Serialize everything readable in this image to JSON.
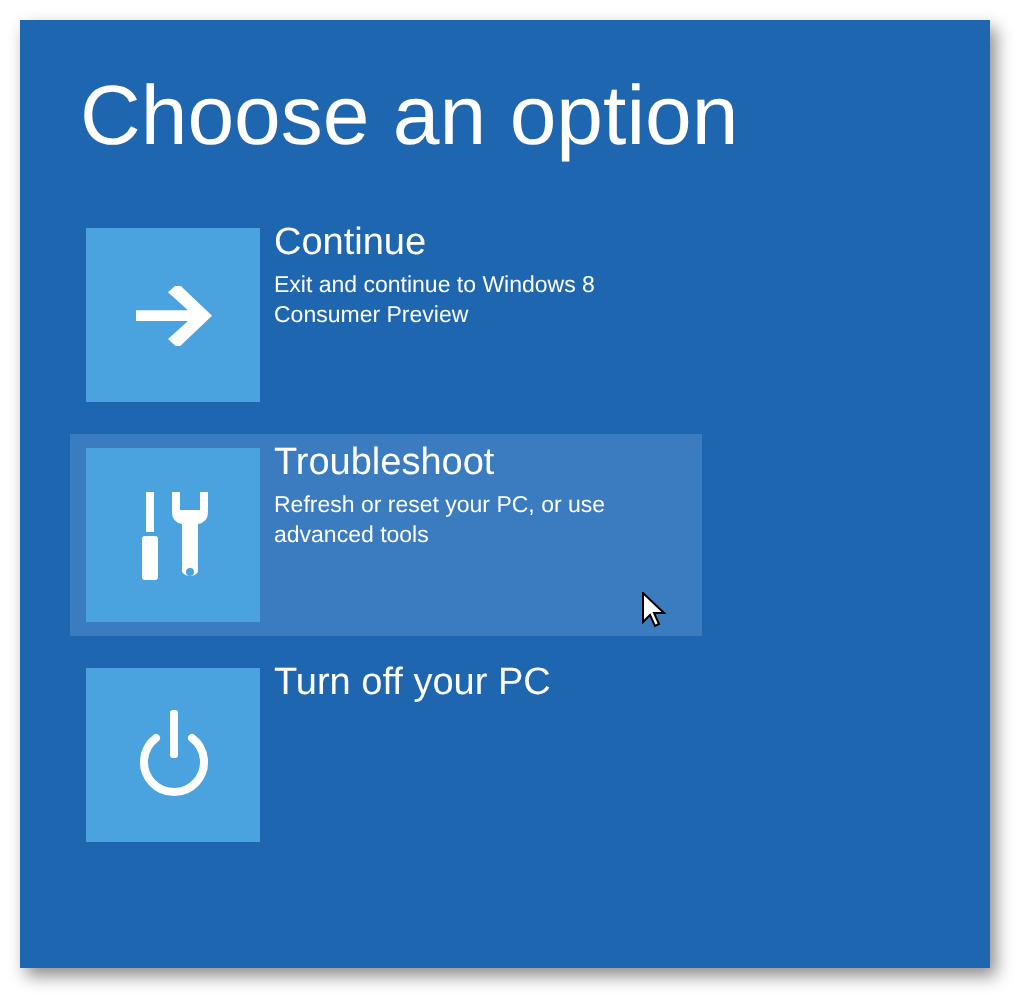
{
  "title": "Choose an option",
  "options": [
    {
      "kind": "arrow",
      "label": "Continue",
      "description": "Exit and continue to Windows 8 Consumer Preview",
      "selected": false
    },
    {
      "kind": "tools",
      "label": "Troubleshoot",
      "description": "Refresh or reset your PC, or use advanced tools",
      "selected": true
    },
    {
      "kind": "power",
      "label": "Turn off your PC",
      "selected": false
    }
  ]
}
